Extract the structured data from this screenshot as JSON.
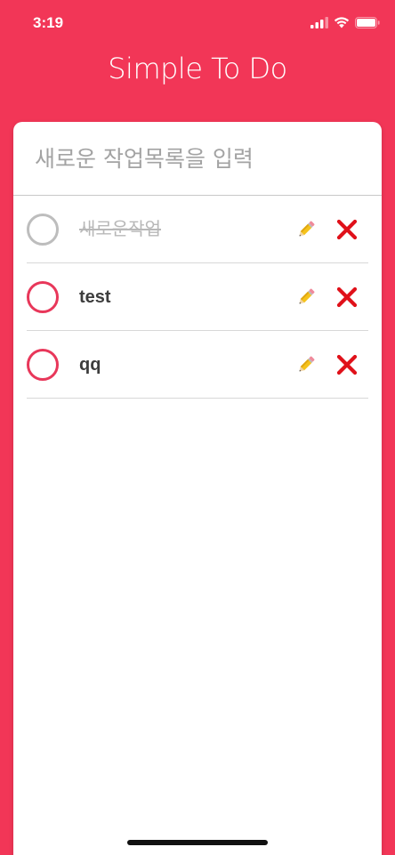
{
  "status_bar": {
    "time": "3:19"
  },
  "app": {
    "title": "Simple To Do"
  },
  "new_task": {
    "placeholder": "새로운 작업목록을 입력",
    "value": ""
  },
  "tasks": [
    {
      "text": "새로운작업",
      "completed": true
    },
    {
      "text": "test",
      "completed": false
    },
    {
      "text": "qq",
      "completed": false
    }
  ],
  "icons": {
    "edit": "pencil-icon",
    "delete": "cross-mark-icon",
    "status": [
      "cellular-signal-icon",
      "wifi-icon",
      "battery-icon"
    ]
  },
  "colors": {
    "background": "#f23657",
    "accent": "#e8375a",
    "completed": "#bdbdbd",
    "delete": "#e0111a"
  }
}
